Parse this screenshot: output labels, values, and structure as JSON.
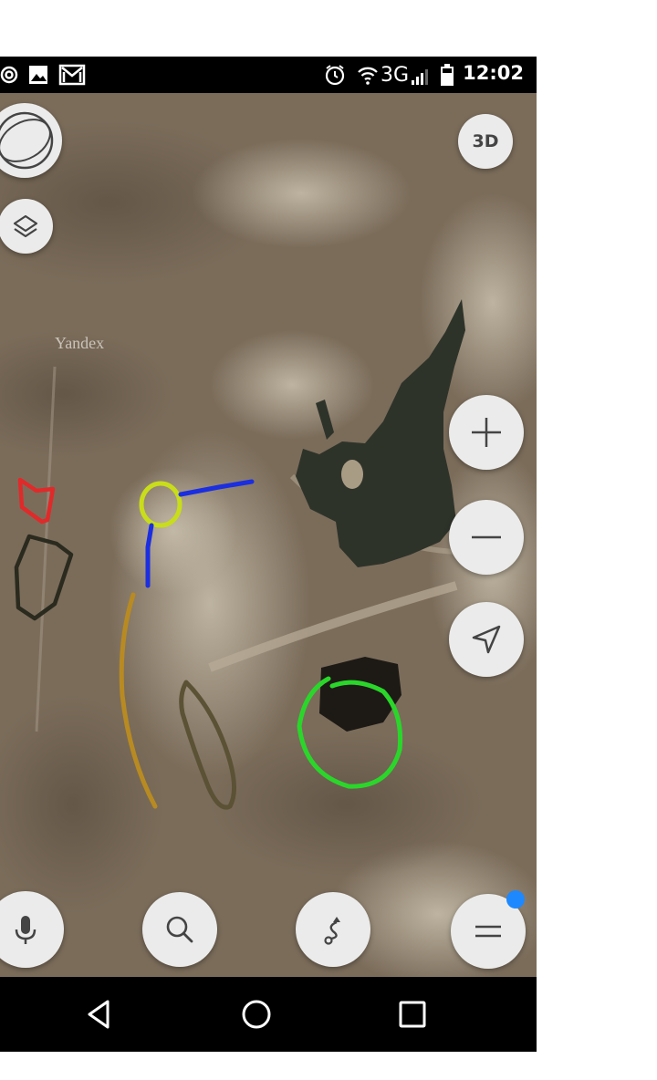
{
  "status_bar": {
    "time": "12:02",
    "network": "3G",
    "left_icons": [
      "at-icon",
      "image-icon",
      "gmail-icon"
    ],
    "right_icons": [
      "alarm-icon",
      "wifi-icon",
      "signal-icon",
      "battery-icon"
    ]
  },
  "map": {
    "watermark": "Yandex",
    "view_3d_label": "3D",
    "annotations": [
      "red",
      "yellow-green",
      "blue",
      "dark-brown",
      "gold",
      "olive",
      "green"
    ]
  },
  "bottom_bar": {
    "buttons": [
      "microphone-icon",
      "search-icon",
      "route-icon",
      "menu-icon"
    ],
    "menu_badge_color": "#1e88ff"
  },
  "nav_bar": [
    "back-icon",
    "home-icon",
    "recents-icon"
  ],
  "colors": {
    "annotation_red": "#e02a2a",
    "annotation_yellow": "#c9dd1a",
    "annotation_blue": "#1b2ee0",
    "annotation_green": "#2ad62a",
    "annotation_gold": "#b88a22",
    "annotation_olive": "#5b5236",
    "annotation_dark": "#2a2a1e"
  }
}
